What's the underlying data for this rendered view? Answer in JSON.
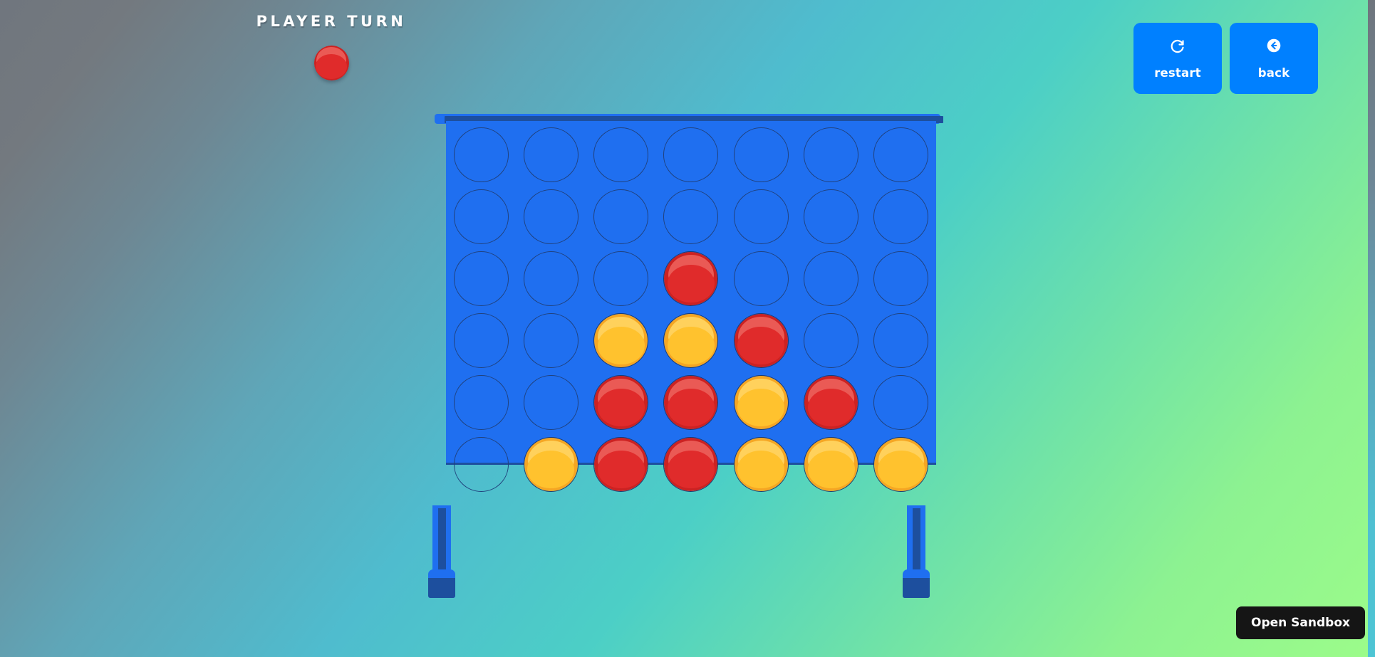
{
  "header": {
    "turn_label": "PLAYER TURN",
    "turn_disc_color": "red"
  },
  "actions": {
    "buttons": [
      {
        "label": "restart",
        "icon": "rotate-clockwise-icon"
      },
      {
        "label": "back",
        "icon": "arrow-left-circle-icon"
      }
    ]
  },
  "board": {
    "columns": 7,
    "rows": 6,
    "frame_color": "#1f6ff0",
    "frame_shadow_color": "#1d4f9e",
    "hole_outline_color": "#20417c",
    "cells": [
      [
        "empty",
        "empty",
        "empty",
        "empty",
        "empty",
        "empty",
        "empty"
      ],
      [
        "empty",
        "empty",
        "empty",
        "empty",
        "empty",
        "empty",
        "empty"
      ],
      [
        "empty",
        "empty",
        "empty",
        "red",
        "empty",
        "empty",
        "empty"
      ],
      [
        "empty",
        "empty",
        "yellow",
        "yellow",
        "red",
        "empty",
        "empty"
      ],
      [
        "empty",
        "empty",
        "red",
        "red",
        "yellow",
        "red",
        "empty"
      ],
      [
        "empty",
        "yellow",
        "red",
        "red",
        "yellow",
        "yellow",
        "yellow"
      ]
    ]
  },
  "colors": {
    "red_light": "#ea5a55",
    "red_mid": "#e02b2b",
    "red_dark": "#cc2222",
    "yellow_light": "#ffd15c",
    "yellow_mid": "#ffc22e",
    "yellow_dark": "#f5a623",
    "button_blue": "#0080ff",
    "sandbox_bg": "#151515"
  },
  "footer": {
    "open_sandbox_label": "Open Sandbox"
  }
}
